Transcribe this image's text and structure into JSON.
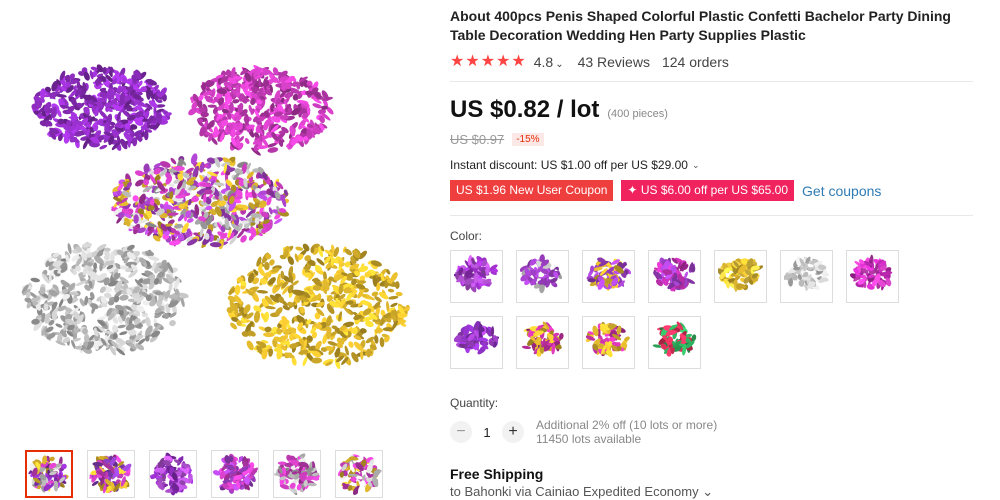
{
  "product": {
    "title": "About 400pcs Penis Shaped Colorful Plastic Confetti Bachelor Party Dining Table Decoration Wedding Hen Party Supplies Plastic",
    "rating": "4.8",
    "rating_value": 4.8,
    "reviews": "43 Reviews",
    "orders": "124 orders"
  },
  "price": {
    "current": "US $0.82 / lot",
    "pieces": "(400 pieces)",
    "original": "US $0.97",
    "discount": "-15%"
  },
  "discount_info": {
    "instant": "Instant discount: US $1.00 off per US $29.00"
  },
  "coupons": {
    "new_user": "US $1.96 New User Coupon",
    "store": "US $6.00 off per US $65.00",
    "store_icon": "plus-icon",
    "get": "Get coupons"
  },
  "color": {
    "label": "Color:",
    "swatches": [
      {
        "colors": [
          "#9b2fc6",
          "#b050d0"
        ]
      },
      {
        "colors": [
          "#a040c8",
          "#cfcfcf"
        ]
      },
      {
        "colors": [
          "#d8b12c",
          "#a040c8"
        ]
      },
      {
        "colors": [
          "#c030b0",
          "#a040c8"
        ]
      },
      {
        "colors": [
          "#d8b12c",
          "#e0c040"
        ]
      },
      {
        "colors": [
          "#bfbfbf",
          "#d8d8d8"
        ]
      },
      {
        "colors": [
          "#c32ab8",
          "#d040c0"
        ]
      },
      {
        "colors": [
          "#8a30c0",
          "#a040c8"
        ]
      },
      {
        "colors": [
          "#c030a0",
          "#d8b12c"
        ]
      },
      {
        "colors": [
          "#c030a0",
          "#d8b12c"
        ]
      },
      {
        "colors": [
          "#2eaa5a",
          "#e0305a"
        ]
      }
    ]
  },
  "quantity": {
    "label": "Quantity:",
    "value": "1",
    "note1": "Additional 2% off (10 lots or more)",
    "note2": "11450 lots available"
  },
  "shipping": {
    "title": "Free Shipping",
    "detail": "to Bahonki via Cainiao Expedited Economy"
  },
  "gallery": {
    "piles": [
      {
        "name": "purple",
        "color": "#8e2dbf"
      },
      {
        "name": "magenta",
        "color": "#c53bb8"
      },
      {
        "name": "mixed",
        "color": "#a13fc0"
      },
      {
        "name": "silver",
        "color": "#b9b9b9"
      },
      {
        "name": "gold",
        "color": "#d9b22c"
      }
    ],
    "thumbs": [
      "mixed",
      "gold-magenta",
      "purple",
      "magenta",
      "magenta-silver",
      "gold-label"
    ]
  },
  "colors": {
    "accent": "#e62e04",
    "star": "#ff4747",
    "link": "#2f7bb3",
    "coupon_red": "#ee3e3e",
    "coupon_pink": "#f0235f"
  }
}
